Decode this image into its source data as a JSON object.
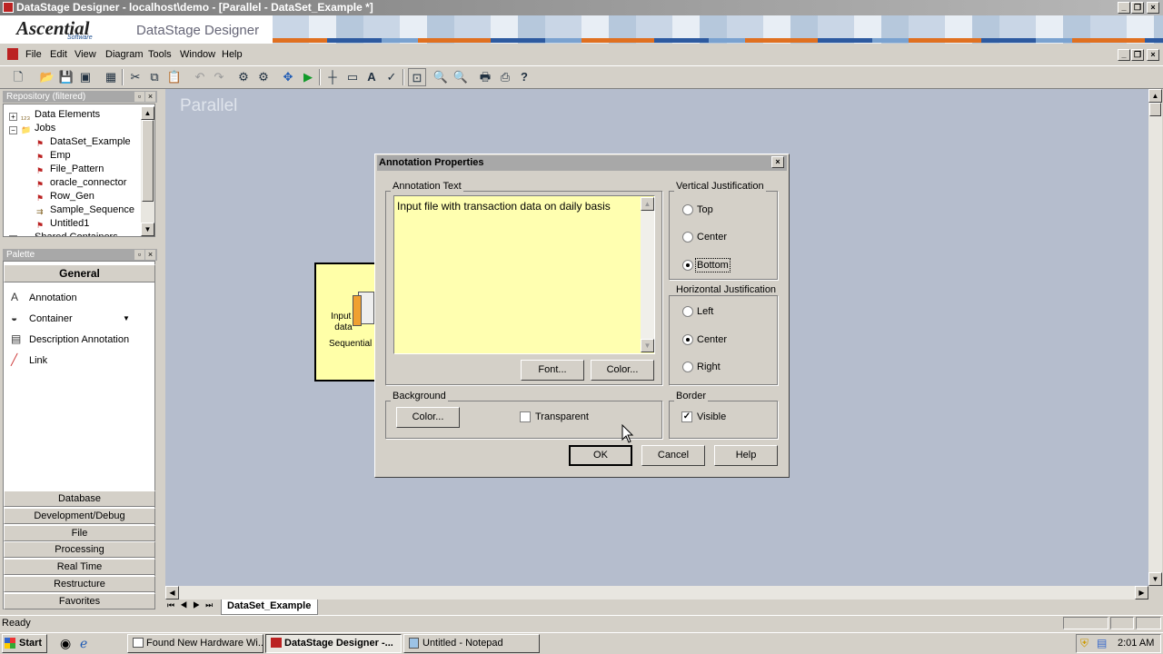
{
  "window": {
    "title": "DataStage Designer - localhost\\demo - [Parallel - DataSet_Example *]"
  },
  "banner": {
    "logo": "Ascential",
    "logo_sub": "Software",
    "product": "DataStage Designer"
  },
  "menu": [
    "File",
    "Edit",
    "View",
    "Diagram",
    "Tools",
    "Window",
    "Help"
  ],
  "repository": {
    "title": "Repository (filtered)",
    "items": [
      {
        "label": "Data Elements",
        "indent": 0,
        "icon": "data-elements-icon"
      },
      {
        "label": "Jobs",
        "indent": 0,
        "icon": "folder-icon"
      },
      {
        "label": "DataSet_Example",
        "indent": 1,
        "icon": "job-icon"
      },
      {
        "label": "Emp",
        "indent": 1,
        "icon": "job-icon"
      },
      {
        "label": "File_Pattern",
        "indent": 1,
        "icon": "job-icon"
      },
      {
        "label": "oracle_connector",
        "indent": 1,
        "icon": "job-icon"
      },
      {
        "label": "Row_Gen",
        "indent": 1,
        "icon": "job-icon"
      },
      {
        "label": "Sample_Sequence",
        "indent": 1,
        "icon": "sequence-icon"
      },
      {
        "label": "Untitled1",
        "indent": 1,
        "icon": "job-icon"
      },
      {
        "label": "Shared Containers",
        "indent": 0,
        "icon": "container-icon"
      }
    ]
  },
  "palette": {
    "title": "Palette",
    "active_category": "General",
    "general_items": [
      {
        "label": "Annotation",
        "icon": "annotation-icon"
      },
      {
        "label": "Container",
        "icon": "container-icon"
      },
      {
        "label": "Description Annotation",
        "icon": "description-annotation-icon"
      },
      {
        "label": "Link",
        "icon": "link-icon"
      }
    ],
    "categories": [
      "Database",
      "Development/Debug",
      "File",
      "Processing",
      "Real Time",
      "Restructure",
      "Favorites"
    ]
  },
  "canvas": {
    "watermark": "Parallel",
    "stage_annotation": "Input f data",
    "stage_label": "Sequential"
  },
  "tabs": {
    "active": "DataSet_Example"
  },
  "status": {
    "text": "Ready"
  },
  "taskbar": {
    "start": "Start",
    "tasks": [
      "Found New Hardware Wi...",
      "DataStage Designer -...",
      "Untitled - Notepad"
    ],
    "clock": "2:01 AM"
  },
  "dialog": {
    "title": "Annotation Properties",
    "annotation_text_label": "Annotation Text",
    "annotation_text": "Input file with transaction data on daily basis",
    "font_button": "Font...",
    "color_button": "Color...",
    "vertical": {
      "label": "Vertical Justification",
      "options": [
        "Top",
        "Center",
        "Bottom"
      ],
      "selected": "Bottom"
    },
    "horizontal": {
      "label": "Horizontal Justification",
      "options": [
        "Left",
        "Center",
        "Right"
      ],
      "selected": "Center"
    },
    "background": {
      "label": "Background",
      "color_button": "Color...",
      "transparent_label": "Transparent",
      "transparent": false
    },
    "border": {
      "label": "Border",
      "visible_label": "Visible",
      "visible": true
    },
    "ok": "OK",
    "cancel": "Cancel",
    "help": "Help"
  },
  "colors": {
    "annotation_bg": "#ffffb0",
    "canvas": "#b5bdcd",
    "stage_bg": "#ffffa8",
    "title_inactive": "#a8a8a8"
  }
}
